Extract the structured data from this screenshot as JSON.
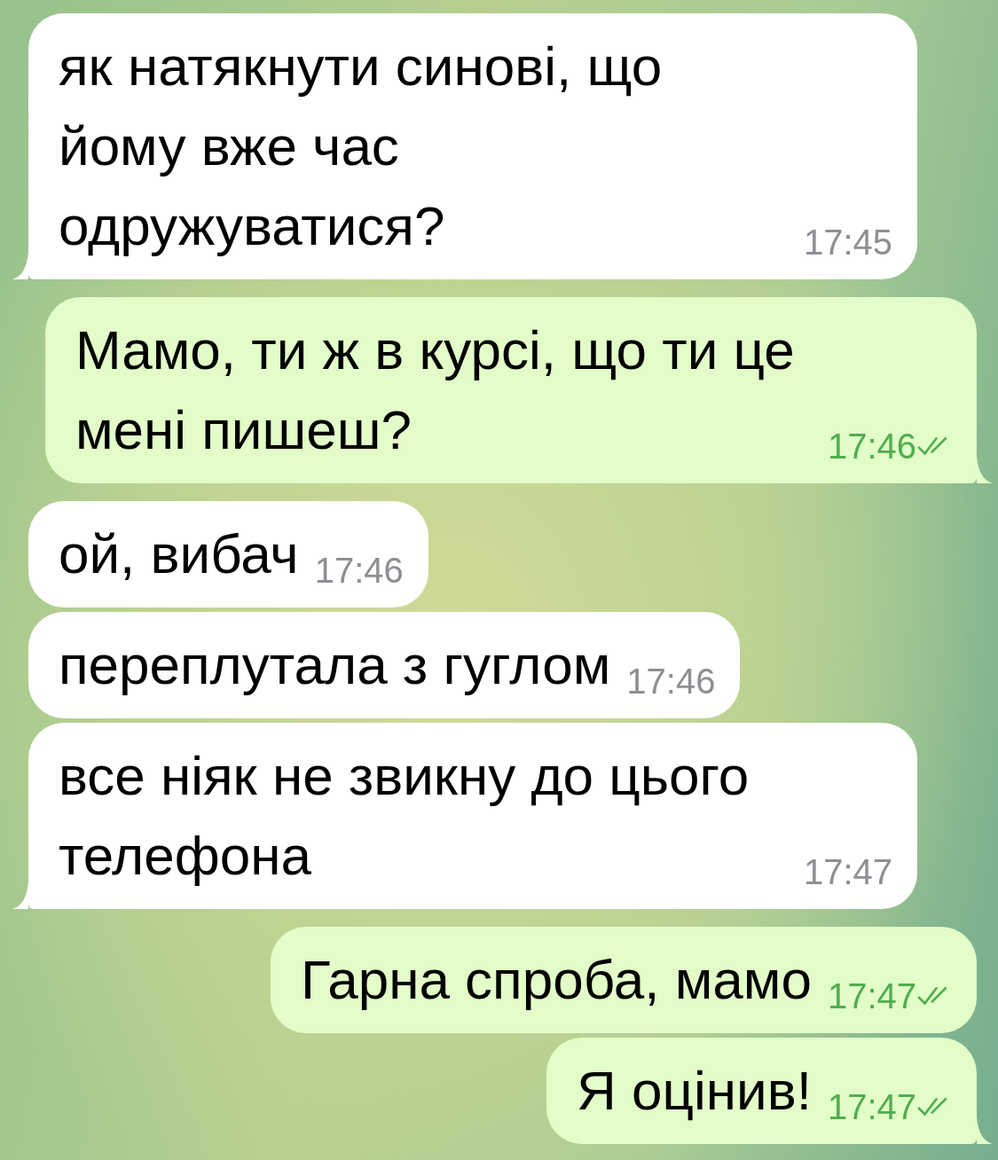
{
  "messages": [
    {
      "kind": "incoming",
      "text": "як натякнути синові, що йому вже час одружуватися?",
      "time": "17:45",
      "tail": true
    },
    {
      "kind": "outgoing",
      "text": "Мамо, ти ж в курсі, що ти це мені пишеш?",
      "time": "17:46",
      "tail": true,
      "read": true
    },
    {
      "kind": "incoming",
      "text": "ой, вибач",
      "time": "17:46",
      "tail": false
    },
    {
      "kind": "incoming",
      "text": "переплутала з гуглом",
      "time": "17:46",
      "tail": false
    },
    {
      "kind": "incoming",
      "text": "все ніяк не звикну до цього телефона",
      "time": "17:47",
      "tail": true
    },
    {
      "kind": "outgoing",
      "text": "Гарна спроба, мамо",
      "time": "17:47",
      "tail": false,
      "read": true
    },
    {
      "kind": "outgoing",
      "text": "Я оцінив!",
      "time": "17:47",
      "tail": true,
      "read": true
    }
  ]
}
